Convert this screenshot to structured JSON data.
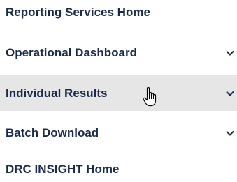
{
  "nav": {
    "items": [
      {
        "label": "Reporting Services Home",
        "expandable": false,
        "hovered": false
      },
      {
        "label": "Operational Dashboard",
        "expandable": true,
        "hovered": false
      },
      {
        "label": "Individual Results",
        "expandable": true,
        "hovered": true
      },
      {
        "label": "Batch Download",
        "expandable": true,
        "hovered": false
      },
      {
        "label": "DRC INSIGHT Home",
        "expandable": false,
        "hovered": false
      }
    ]
  },
  "icons": {
    "expand": "chevron-down-icon",
    "cursor": "hand-pointer-cursor-icon"
  },
  "colors": {
    "text": "#1b2a4a",
    "hover_bg": "#e6e6e6",
    "background": "#ffffff"
  }
}
